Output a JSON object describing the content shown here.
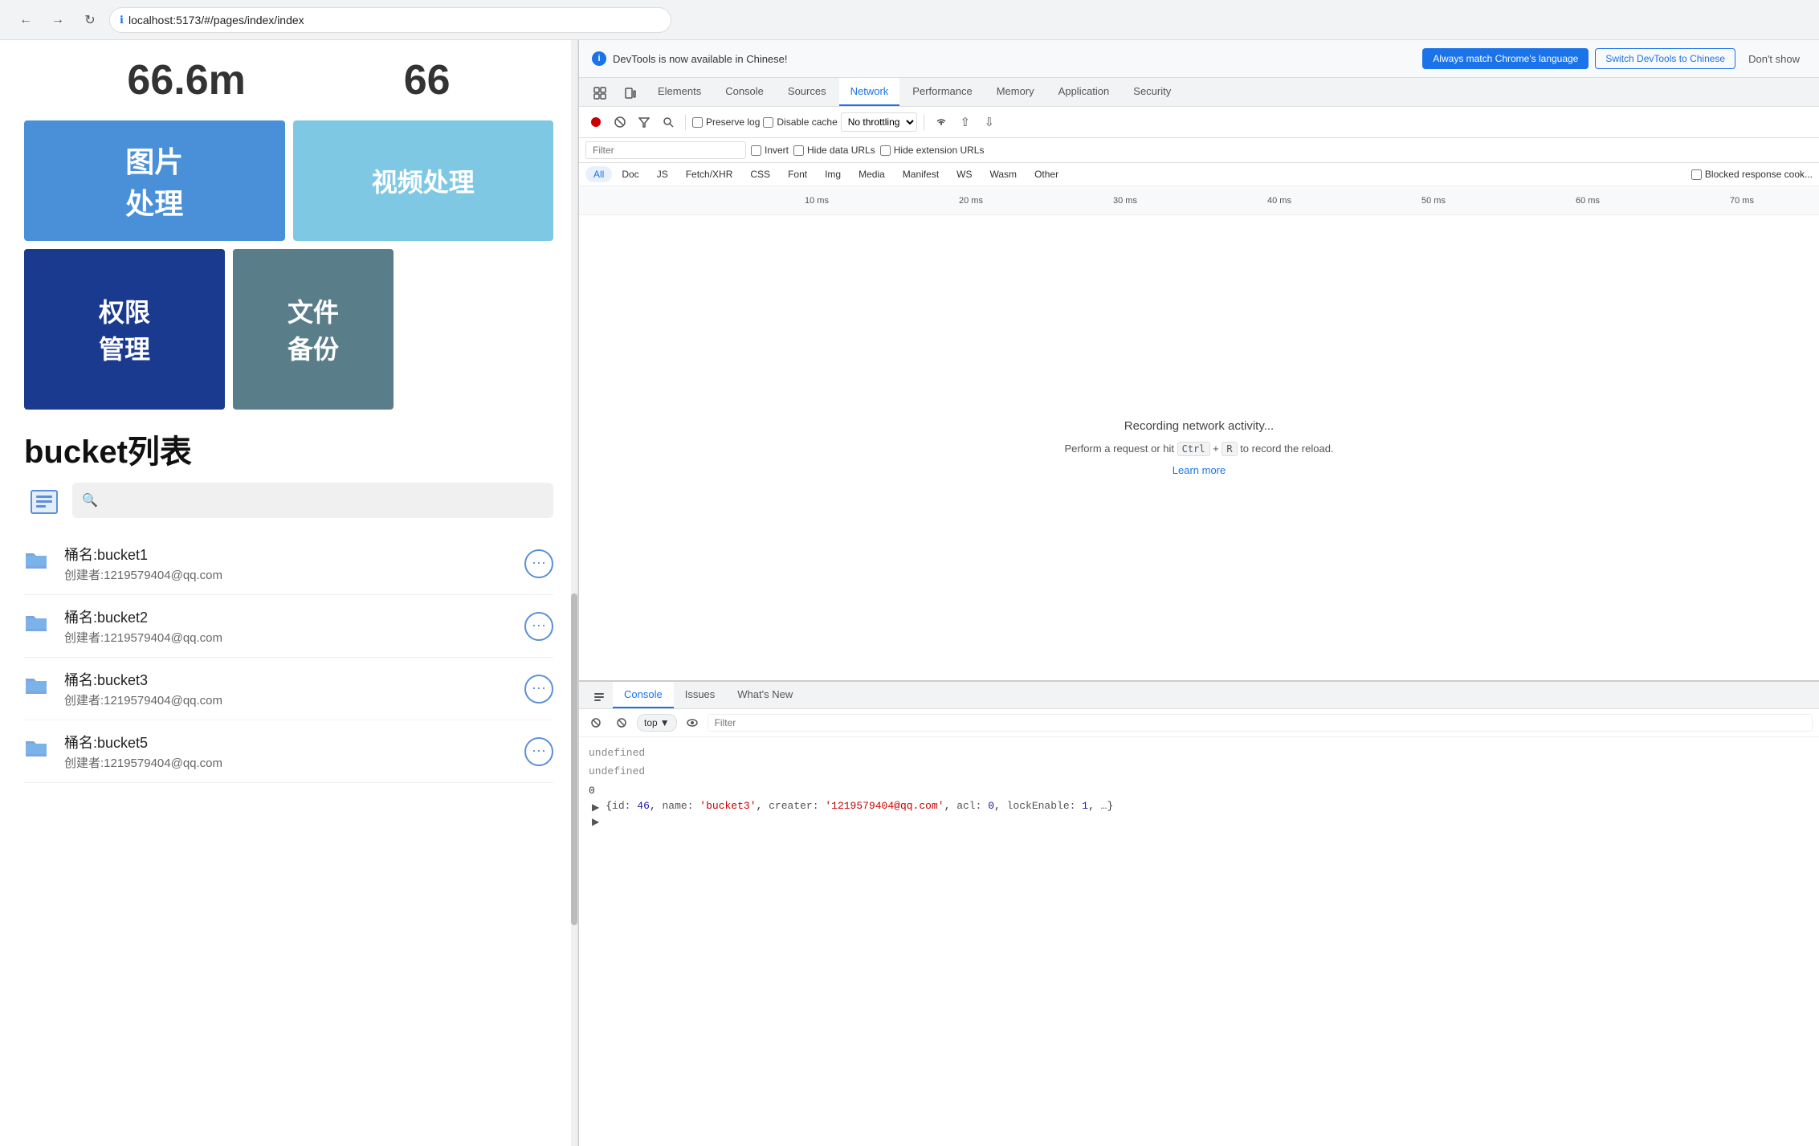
{
  "browser": {
    "back_label": "←",
    "forward_label": "→",
    "refresh_label": "↻",
    "url": "localhost:5173/#/pages/index/index"
  },
  "page": {
    "stat1": "66.6m",
    "stat2": "66",
    "card_img": "图片\n处理",
    "card_video": "视频处理",
    "card_perm": "权限\n管理",
    "card_file": "文件\n备份",
    "bucket_title": "bucket列表",
    "search_placeholder": "",
    "buckets": [
      {
        "name": "桶名:bucket1",
        "creator": "创建者:1219579404@qq.com"
      },
      {
        "name": "桶名:bucket2",
        "creator": "创建者:1219579404@qq.com"
      },
      {
        "name": "桶名:bucket3",
        "creator": "创建者:1219579404@qq.com"
      },
      {
        "name": "桶名:bucket5",
        "creator": "创建者:1219579404@qq.com"
      }
    ]
  },
  "devtools": {
    "notification": {
      "text": "DevTools is now available in Chinese!",
      "btn1": "Always match Chrome's language",
      "btn2": "Switch DevTools to Chinese",
      "dismiss": "Don't show"
    },
    "tabs": [
      "Elements",
      "Console",
      "Sources",
      "Network",
      "Performance",
      "Memory",
      "Application",
      "Security"
    ],
    "active_tab": "Network",
    "toolbar": {
      "record_label": "●",
      "clear_label": "🚫",
      "filter_label": "≡",
      "search_label": "🔍",
      "preserve_log": "Preserve log",
      "disable_cache": "Disable cache",
      "throttle": "No throttling",
      "import_label": "⬆",
      "export_label": "⬇"
    },
    "filter_placeholder": "Filter",
    "invert": "Invert",
    "hide_data_urls": "Hide data URLs",
    "hide_ext_urls": "Hide extension URLs",
    "net_tabs": [
      "All",
      "Doc",
      "JS",
      "Fetch/XHR",
      "CSS",
      "Font",
      "Img",
      "Media",
      "Manifest",
      "WS",
      "Wasm",
      "Other"
    ],
    "blocked_response": "Blocked response cook...",
    "timeline": {
      "labels": [
        "10 ms",
        "20 ms",
        "30 ms",
        "40 ms",
        "50 ms",
        "60 ms",
        "70 ms"
      ]
    },
    "recording_title": "Recording network activity...",
    "recording_sub": "Perform a request or hit Ctrl + R to record the reload.",
    "learn_more": "Learn more",
    "console_tabs": [
      "Console",
      "Issues",
      "What's New"
    ],
    "active_console_tab": "Console",
    "console_toolbar": {
      "top_label": "top",
      "filter_placeholder": "Filter",
      "eye_label": "👁"
    },
    "console_lines": [
      {
        "type": "undefined",
        "value": "undefined"
      },
      {
        "type": "undefined",
        "value": "undefined"
      },
      {
        "type": "number",
        "value": "0"
      },
      {
        "type": "object",
        "value": "▶ {id: 46, name: 'bucket3', creater: '1219579404@qq.com', acl: 0, lockEnable: 1, …}"
      },
      {
        "type": "expand",
        "value": "▶"
      }
    ]
  }
}
